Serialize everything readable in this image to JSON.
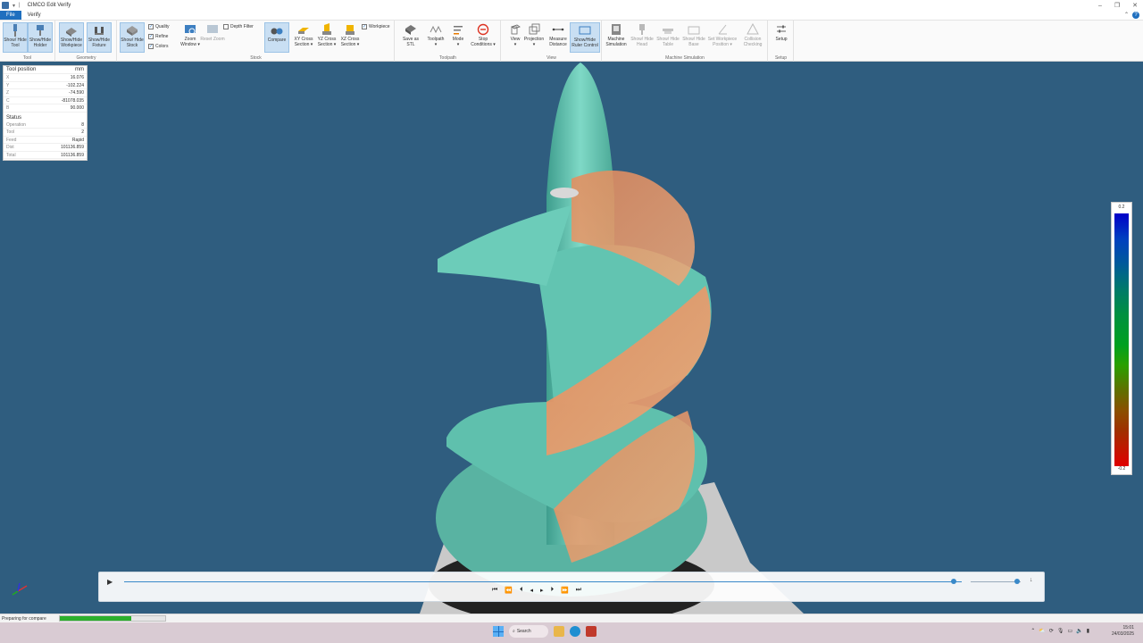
{
  "titlebar": {
    "title": "CIMCO Edit Verify",
    "min": "–",
    "restore": "❐",
    "close": "✕"
  },
  "tabs": [
    {
      "label": "File",
      "active": true
    },
    {
      "label": "Verify",
      "active": false
    }
  ],
  "ribbon": {
    "groups": [
      {
        "label": "Tool",
        "buttons": [
          "Show/ Hide Tool",
          "Show/Hide Holder"
        ]
      },
      {
        "label": "Geometry",
        "buttons": [
          "Show/Hide Workpiece",
          "Show/Hide Fixture"
        ]
      },
      {
        "label": "Stock",
        "buttons": [
          "Show/ Hide Stock",
          "Zoom Window",
          "Reset Zoom",
          "Compare",
          "XY Cross Section",
          "YZ Cross Section",
          "XZ Cross Section"
        ]
      },
      {
        "label": "Toolpath",
        "buttons": [
          "Save as STL",
          "Toolpath",
          "Mode",
          "Stop Conditions"
        ]
      },
      {
        "label": "View",
        "buttons": [
          "View",
          "Projection",
          "Measure Distance",
          "Show/Hide Ruler Control"
        ]
      },
      {
        "label": "Machine Simulation",
        "buttons": [
          "Machine Simulation",
          "Show/ Hide Head",
          "Show/ Hide Table",
          "Show/ Hide Base",
          "Set Workpiece Position",
          "Collision Checking"
        ]
      },
      {
        "label": "Setup",
        "buttons": [
          "Setup"
        ]
      }
    ],
    "checks": {
      "quality": "Quality",
      "refine": "Refine",
      "colors": "Colors",
      "depth_filter": "Depth Filter",
      "workpiece": "Workpiece"
    }
  },
  "info_panel": {
    "header": "Tool position",
    "unit": "mm",
    "position": [
      {
        "k": "X",
        "v": "16.076"
      },
      {
        "k": "Y",
        "v": "-102.224"
      },
      {
        "k": "Z",
        "v": "-74.590"
      },
      {
        "k": "C",
        "v": "-81078.035"
      },
      {
        "k": "B",
        "v": "90.000"
      }
    ],
    "status_header": "Status",
    "status": [
      {
        "k": "Operation",
        "v": "8"
      },
      {
        "k": "Tool",
        "v": "2"
      },
      {
        "k": "Feed",
        "v": "Rapid"
      },
      {
        "k": "Dist",
        "v": "101136.859"
      },
      {
        "k": "Total",
        "v": "101136.859"
      }
    ]
  },
  "legend": {
    "max": "0.2",
    "min": "-0.2"
  },
  "playbar": {
    "position_fraction": 0.99,
    "speed_fraction": 0.93
  },
  "statusbar": {
    "text": "Preparing for compare",
    "progress_fraction": 0.68
  },
  "taskbar": {
    "search": "Search",
    "time": "15:01",
    "date": "24/03/2025"
  }
}
